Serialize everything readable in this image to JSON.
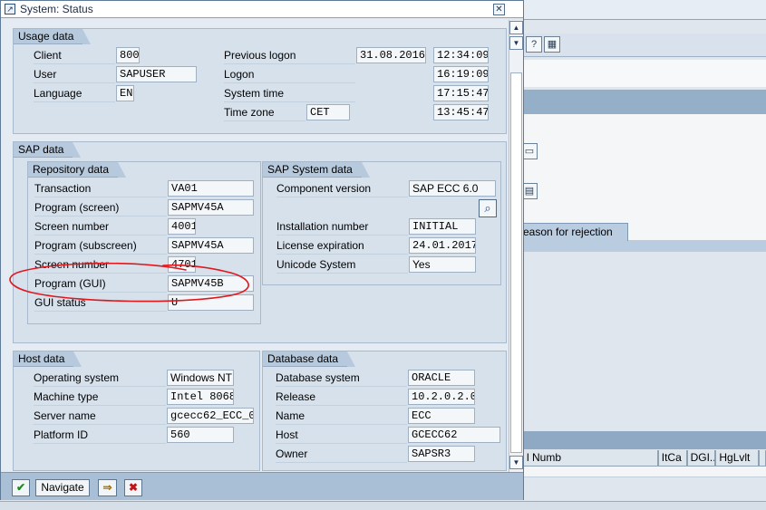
{
  "dialog": {
    "title": "System: Status"
  },
  "usage_data": {
    "header": "Usage data",
    "client_label": "Client",
    "client_value": "800",
    "user_label": "User",
    "user_value": "SAPUSER",
    "language_label": "Language",
    "language_value": "EN",
    "previous_logon_label": "Previous logon",
    "previous_logon_date": "31.08.2016",
    "previous_logon_time": "12:34:09",
    "logon_label": "Logon",
    "logon_time": "16:19:09",
    "system_time_label": "System time",
    "system_time_value": "17:15:47",
    "time_zone_label": "Time zone",
    "time_zone_value": "CET",
    "time_zone_time": "13:45:47"
  },
  "sap_data": {
    "header": "SAP data",
    "repository": {
      "header": "Repository data",
      "rows": [
        {
          "label": "Transaction",
          "value": "VA01"
        },
        {
          "label": "Program (screen)",
          "value": "SAPMV45A"
        },
        {
          "label": "Screen number",
          "value": "4001"
        },
        {
          "label": "Program (subscreen)",
          "value": "SAPMV45A"
        },
        {
          "label": "Screen number",
          "value": "4701"
        },
        {
          "label": "Program (GUI)",
          "value": "SAPMV45B"
        },
        {
          "label": "GUI status",
          "value": "U"
        }
      ]
    },
    "sap_system": {
      "header": "SAP System data",
      "component_label": "Component version",
      "component_value": "SAP ECC 6.0",
      "installation_label": "Installation number",
      "installation_value": "INITIAL",
      "license_label": "License expiration",
      "license_value": "24.01.2017",
      "unicode_label": "Unicode System",
      "unicode_value": "Yes"
    }
  },
  "host_data": {
    "header": "Host data",
    "rows": [
      {
        "label": "Operating system",
        "value": "Windows NT"
      },
      {
        "label": "Machine type",
        "value": "Intel 8068"
      },
      {
        "label": "Server name",
        "value": "gcecc62_ECC_0("
      },
      {
        "label": "Platform ID",
        "value": "560"
      }
    ]
  },
  "database_data": {
    "header": "Database data",
    "rows": [
      {
        "label": "Database system",
        "value": "ORACLE"
      },
      {
        "label": "Release",
        "value": "10.2.0.2.0"
      },
      {
        "label": "Name",
        "value": "ECC"
      },
      {
        "label": "Host",
        "value": "GCECC62"
      },
      {
        "label": "Owner",
        "value": "SAPSR3"
      }
    ]
  },
  "footer": {
    "navigate_label": "Navigate"
  },
  "background": {
    "tab_label": "eason for rejection",
    "columns": [
      "l Numb",
      "ItCa",
      "DGI..",
      "HgLvlt",
      ""
    ]
  },
  "colors": {
    "annotation": "#e0181e",
    "dialog_border": "#5f7a96",
    "footer": "#a9bfd6",
    "group_header": "#b7c9dc"
  }
}
